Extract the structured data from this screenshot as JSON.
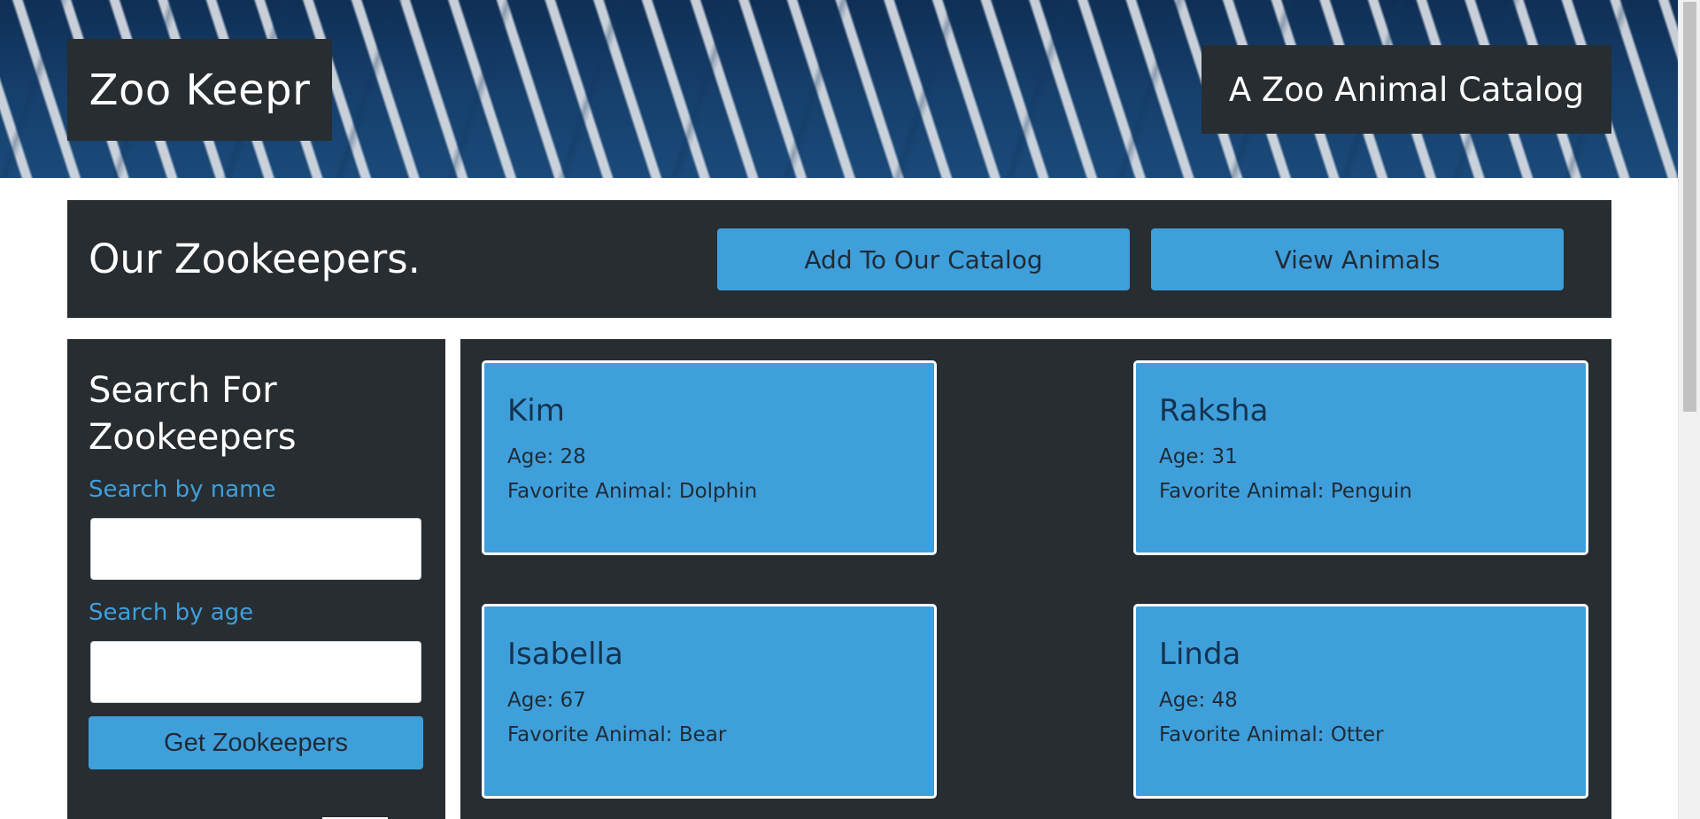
{
  "header": {
    "brand": "Zoo Keepr",
    "tagline": "A Zoo Animal Catalog"
  },
  "title_bar": {
    "title": "Our Zookeepers.",
    "add_button": "Add To Our Catalog",
    "view_button": "View Animals"
  },
  "search": {
    "heading": "Search For Zookeepers",
    "name_label": "Search by name",
    "name_value": "",
    "age_label": "Search by age",
    "age_value": "",
    "submit_label": "Get Zookeepers"
  },
  "zookeepers": [
    {
      "name": "Kim",
      "age": "Age: 28",
      "favorite": "Favorite Animal: Dolphin"
    },
    {
      "name": "Raksha",
      "age": "Age: 31",
      "favorite": "Favorite Animal: Penguin"
    },
    {
      "name": "Isabella",
      "age": "Age: 67",
      "favorite": "Favorite Animal: Bear"
    },
    {
      "name": "Linda",
      "age": "Age: 48",
      "favorite": "Favorite Animal: Otter"
    }
  ],
  "colors": {
    "panel": "#272d31",
    "accent": "#3f9fdb",
    "banner": "#12355e"
  }
}
